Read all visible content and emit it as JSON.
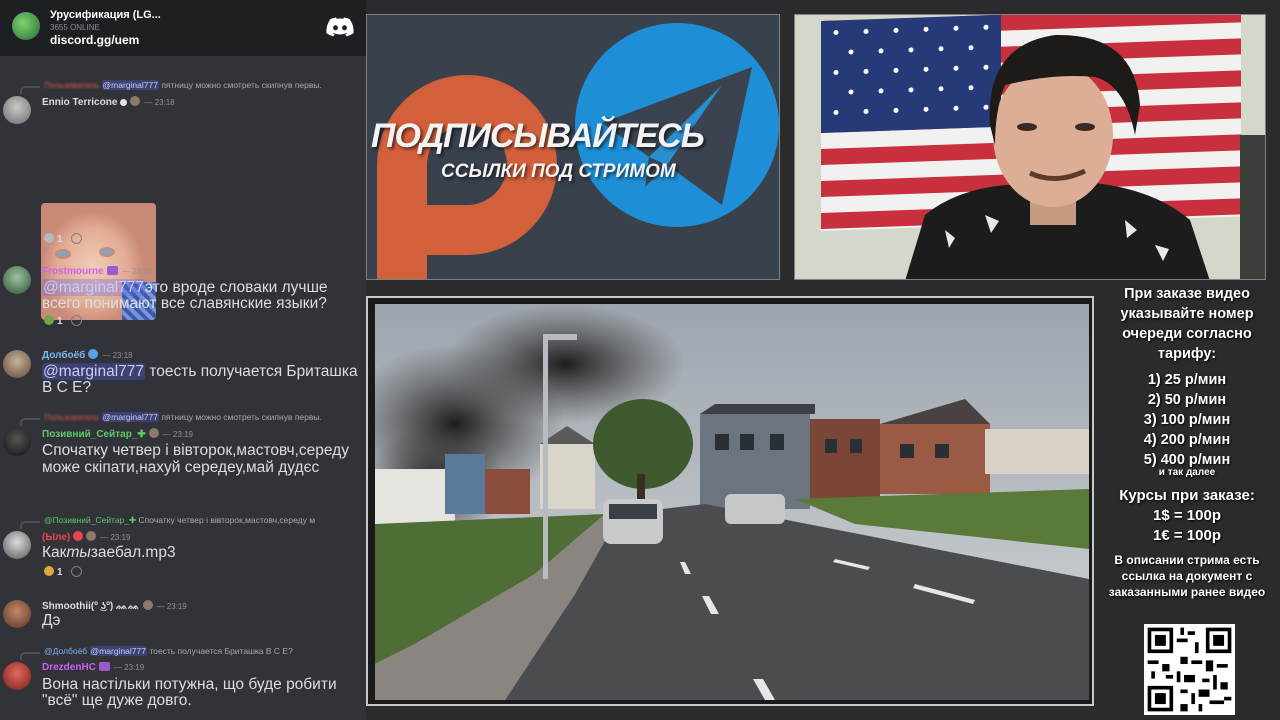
{
  "discord": {
    "server_name": "Урусификация (LG...",
    "online": "3655 ONLINE",
    "invite": "discord.gg/uem",
    "messages": [
      {
        "reply_author": "Пользователь",
        "reply_mention": "@marginal777",
        "reply_text": " пятницу можно смотреть скипнув первы."
      },
      {
        "author": "Ennio Terricone",
        "time": "— 23:18",
        "reactions": [
          "1"
        ]
      },
      {
        "author": "Frostmourne",
        "time": "— 23:18",
        "mention": "@marginal777",
        "text": "это вроде словаки лучше всего понимают все славянские языки?",
        "reactions": [
          "1"
        ]
      },
      {
        "author": "Долбоёб",
        "time": "— 23:18",
        "mention": "@marginal777",
        "text": " тоесть получается Бриташка В С Е?"
      },
      {
        "reply_author": "Пользователь",
        "reply_mention": "@marginal777",
        "reply_text": " пятницу можно смотреть скипнув первы."
      },
      {
        "author": "Позивний_Сейтар_✚",
        "time": "— 23:19",
        "text": "Спочатку четвер і вівторок,мастовч,середу може скіпати,нахуй середеу,май дудєс"
      },
      {
        "reply_author": "@Позивний_Сейтар_✚",
        "reply_text": " Спочатку четвер і вівторок,мастовч,середу м"
      },
      {
        "author": "(Ыле)",
        "time": "— 23:19",
        "text": "Как",
        "text_italic": "ты",
        "text_end": "заебал.mp3",
        "reactions": [
          "1"
        ]
      },
      {
        "author": "Shmoothii(º ͜ʖº) ᨐᨐ",
        "time": "— 23:19",
        "text": "Дэ"
      },
      {
        "reply_author": "@Долбоёб",
        "reply_mention": "@marginal777",
        "reply_text": " тоесть получается Бриташка В С Е?"
      },
      {
        "author": "DrezdenHC",
        "time": "— 23:19",
        "text": "Вона настільки потужна, що буде робити \"всё\" ще дуже довго."
      }
    ]
  },
  "promo": {
    "title": "ПОДПИСЫВАЙТЕСЬ",
    "subtitle": "ССЫЛКИ ПОД СТРИМОМ"
  },
  "info": {
    "order_note": "При заказе видео указывайте номер очереди согласно тарифу:",
    "tariffs": [
      "1) 25 р/мин",
      "2) 50 р/мин",
      "3) 100 р/мин",
      "4) 200 р/мин",
      "5) 400 р/мин"
    ],
    "etc": "и так далее",
    "rates_title": "Курсы при заказе:",
    "rates": [
      "1$ = 100р",
      "1€ = 100р"
    ],
    "description": "В описании стрима есть ссылка на документ с заказанными ранее видео"
  },
  "colors": {
    "discord_bg": "#313338",
    "mention_bg": "#5865f2",
    "promo_orange": "#d2603a",
    "promo_blue": "#1e8fd6"
  }
}
